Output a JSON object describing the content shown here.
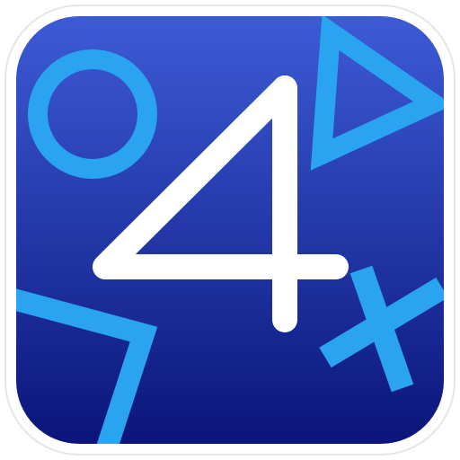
{
  "icon": {
    "glyph": "4",
    "shapes": {
      "circle": "circle-icon",
      "triangle": "triangle-icon",
      "square": "square-icon",
      "cross": "cross-icon"
    }
  },
  "colors": {
    "background_top": "#3d5bd6",
    "background_bottom": "#0a157a",
    "shape_stroke": "#2aa3f0",
    "glyph_stroke": "#ffffff",
    "frame_border": "#e6e6e6",
    "frame_outer": "#ffffff"
  }
}
